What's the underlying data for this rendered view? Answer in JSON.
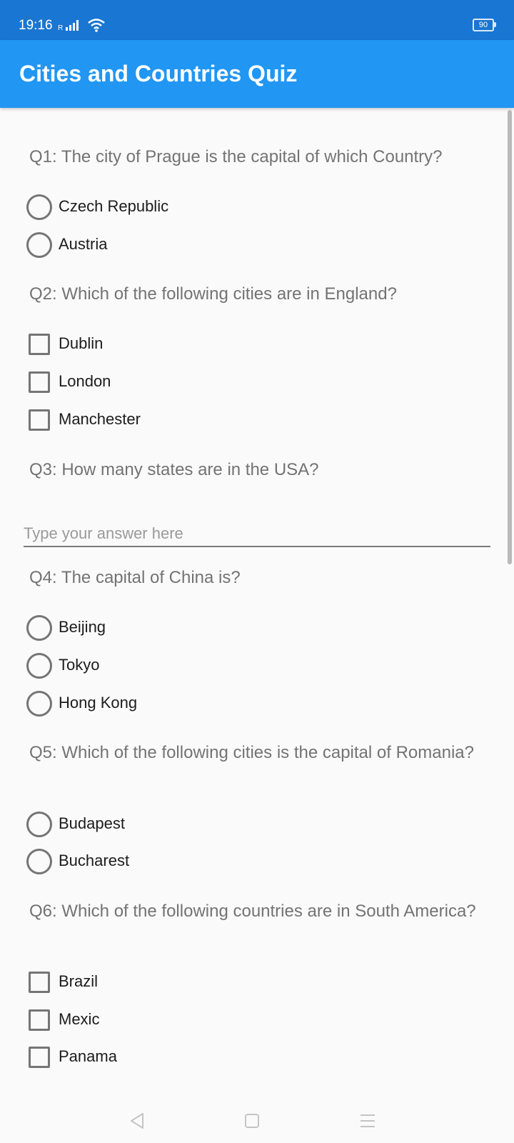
{
  "status_bar": {
    "time": "19:16",
    "signal_label": "R",
    "battery": "90",
    "icons": [
      "signal-icon",
      "wifi-icon",
      "battery-icon"
    ]
  },
  "app_bar": {
    "title": "Cities and Countries Quiz",
    "color": "#2196f3"
  },
  "quiz": {
    "questions": [
      {
        "text": "Q1: The city of Prague is the capital of which Country?",
        "type": "radio",
        "options": [
          "Czech Republic",
          "Austria"
        ]
      },
      {
        "text": "Q2: Which of the following cities are in England?",
        "type": "checkbox",
        "options": [
          "Dublin",
          "London",
          "Manchester"
        ]
      },
      {
        "text": "Q3: How many states are in the USA?",
        "type": "text",
        "placeholder": "Type your answer here",
        "value": ""
      },
      {
        "text": "Q4: The capital of China is?",
        "type": "radio",
        "options": [
          "Beijing",
          "Tokyo",
          "Hong Kong"
        ]
      },
      {
        "text": "Q5: Which of the following cities is the capital of Romania?",
        "type": "radio",
        "options": [
          "Budapest",
          "Bucharest"
        ]
      },
      {
        "text": "Q6: Which of the following countries are in South America?",
        "type": "checkbox",
        "options": [
          "Brazil",
          "Mexic",
          "Panama"
        ]
      }
    ]
  },
  "nav_bar": {
    "buttons": [
      "back-icon",
      "home-icon",
      "menu-icon"
    ]
  }
}
